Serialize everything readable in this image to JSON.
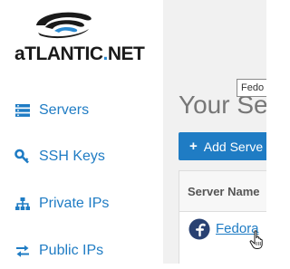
{
  "logo": {
    "text_main": "aTLANTIC",
    "text_dot": ".",
    "text_tld": "NET"
  },
  "sidebar": {
    "items": [
      {
        "label": "Servers",
        "icon": "servers-icon"
      },
      {
        "label": "SSH Keys",
        "icon": "key-icon"
      },
      {
        "label": "Private IPs",
        "icon": "network-icon"
      },
      {
        "label": "Public IPs",
        "icon": "transfer-arrows-icon"
      }
    ]
  },
  "main": {
    "title": "Your Se",
    "add_button": {
      "icon": "plus-icon",
      "label": "Add Serve"
    },
    "table": {
      "header": "Server Name",
      "rows": [
        {
          "name": "Fedora",
          "os_icon": "fedora-icon"
        }
      ]
    },
    "tooltip": "Fedo"
  },
  "colors": {
    "accent": "#1f7cc4",
    "main_bg": "#f1f1f1",
    "title": "#777777"
  }
}
